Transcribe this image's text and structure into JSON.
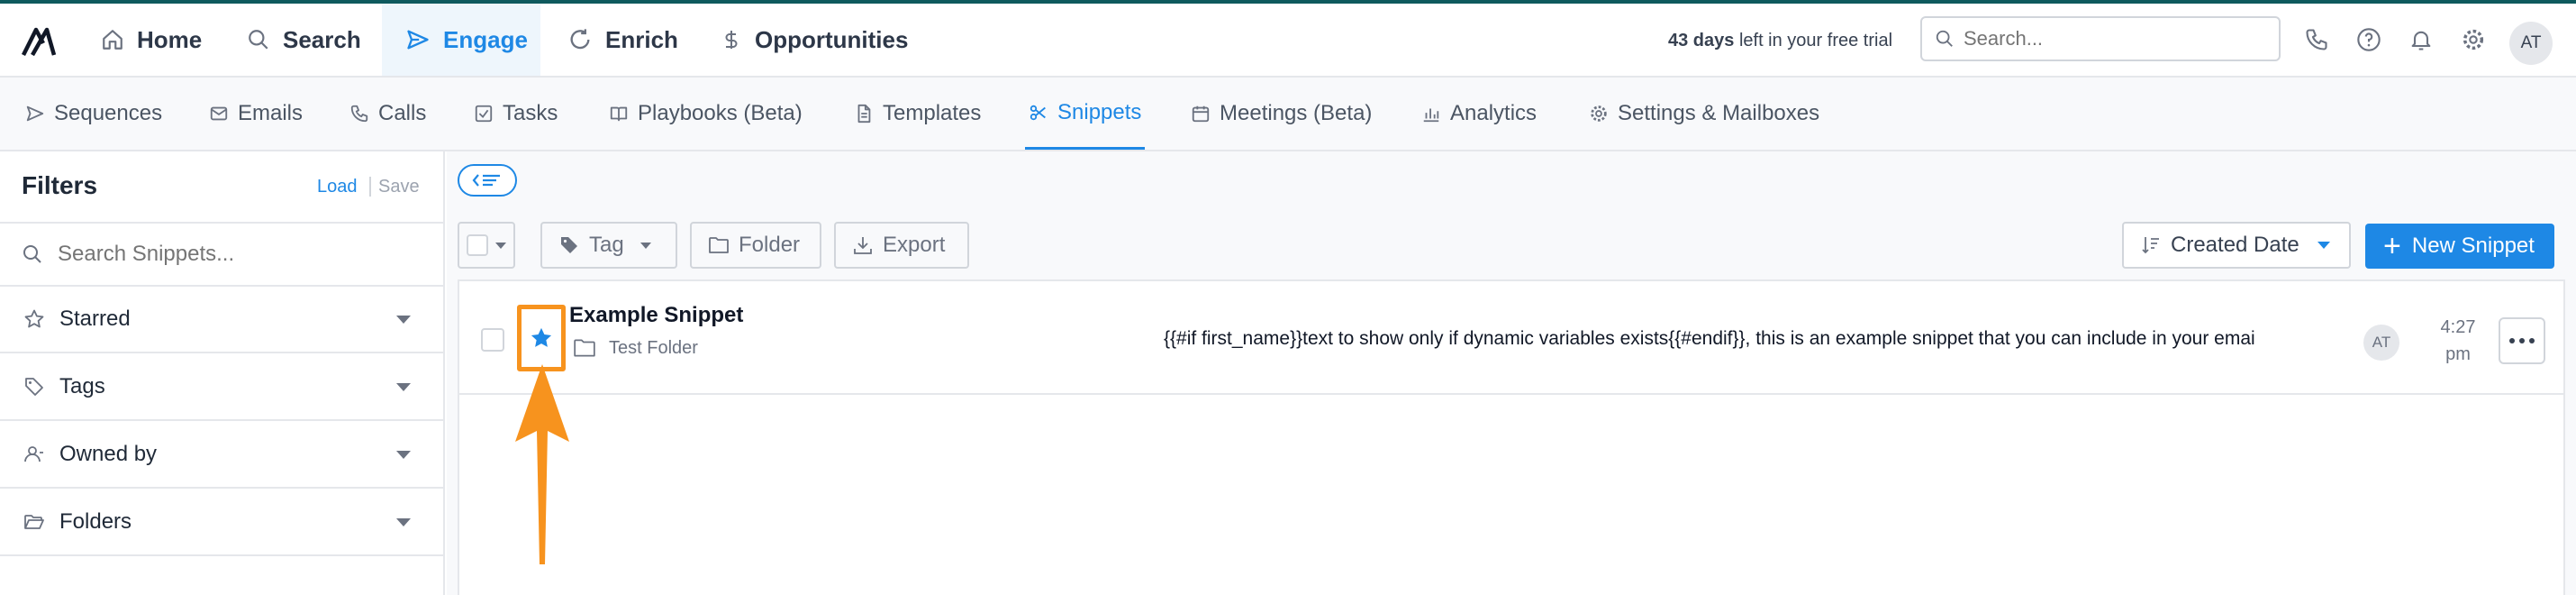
{
  "top_nav": {
    "items": [
      {
        "label": "Home",
        "icon": "home-icon"
      },
      {
        "label": "Search",
        "icon": "search-icon"
      },
      {
        "label": "Engage",
        "icon": "send-icon",
        "active": true
      },
      {
        "label": "Enrich",
        "icon": "refresh-icon"
      },
      {
        "label": "Opportunities",
        "icon": "dollar-icon"
      }
    ],
    "trial_days": "43 days",
    "trial_rest": " left in your free trial",
    "search_placeholder": "Search...",
    "avatar_initials": "AT"
  },
  "sub_nav": {
    "items": [
      {
        "label": "Sequences",
        "icon": "send-icon"
      },
      {
        "label": "Emails",
        "icon": "mail-icon"
      },
      {
        "label": "Calls",
        "icon": "phone-icon"
      },
      {
        "label": "Tasks",
        "icon": "checkbox-icon"
      },
      {
        "label": "Playbooks (Beta)",
        "icon": "book-icon"
      },
      {
        "label": "Templates",
        "icon": "document-icon"
      },
      {
        "label": "Snippets",
        "icon": "scissors-icon",
        "active": true
      },
      {
        "label": "Meetings (Beta)",
        "icon": "calendar-icon"
      },
      {
        "label": "Analytics",
        "icon": "bar-chart-icon"
      },
      {
        "label": "Settings & Mailboxes",
        "icon": "gear-icon"
      }
    ]
  },
  "filters": {
    "title": "Filters",
    "load_label": "Load",
    "save_label": "Save",
    "search_placeholder": "Search Snippets...",
    "items": [
      {
        "label": "Starred",
        "icon": "star-outline-icon"
      },
      {
        "label": "Tags",
        "icon": "tag-icon"
      },
      {
        "label": "Owned by",
        "icon": "user-icon"
      },
      {
        "label": "Folders",
        "icon": "folder-open-icon"
      }
    ]
  },
  "toolbar": {
    "tag_label": "Tag",
    "folder_label": "Folder",
    "export_label": "Export",
    "sort_label": "Created Date",
    "new_label": "New Snippet"
  },
  "snippets": [
    {
      "name": "Example Snippet",
      "folder": "Test Folder",
      "starred": true,
      "body": "{{#if first_name}}text to show only if dynamic variables exists{{#endif}}, this is an example snippet that you can include in your emai",
      "owner_initials": "AT",
      "time": "4:27 pm"
    }
  ],
  "colors": {
    "accent": "#1e88e5",
    "highlight": "#f7931e"
  }
}
